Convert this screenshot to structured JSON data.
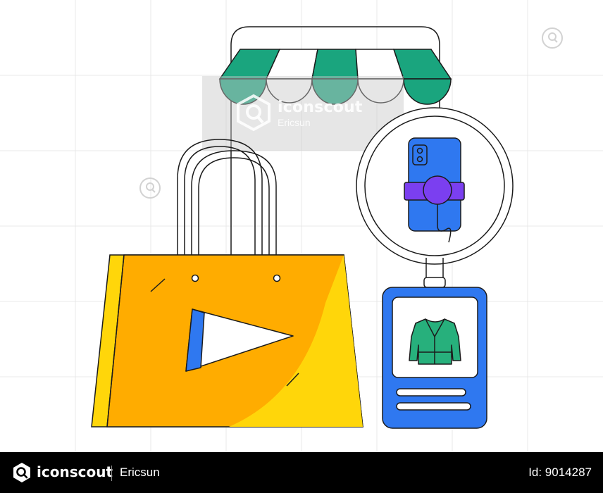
{
  "watermark": {
    "brand": "iconscout",
    "author": "Ericsun"
  },
  "footer": {
    "brand": "iconscout",
    "author": "Ericsun",
    "asset_id": "Id: 9014287"
  },
  "icons": [
    "storefront-awning-icon",
    "shopping-bag-icon",
    "play-icon",
    "ring-light-icon",
    "smartphone-icon",
    "jacket-icon",
    "product-card-icon",
    "iconscout-logo-icon",
    "watermark-search-icon"
  ],
  "colors": {
    "awning_green": "#1aa57e",
    "bag_orange": "#ffac00",
    "bag_yellow": "#ffd60a",
    "phone_blue": "#2f78f0",
    "mount_purple": "#7b3ff0",
    "jacket_green": "#27b07c",
    "play_blue": "#2f78f0",
    "footer_bg": "#000000"
  }
}
